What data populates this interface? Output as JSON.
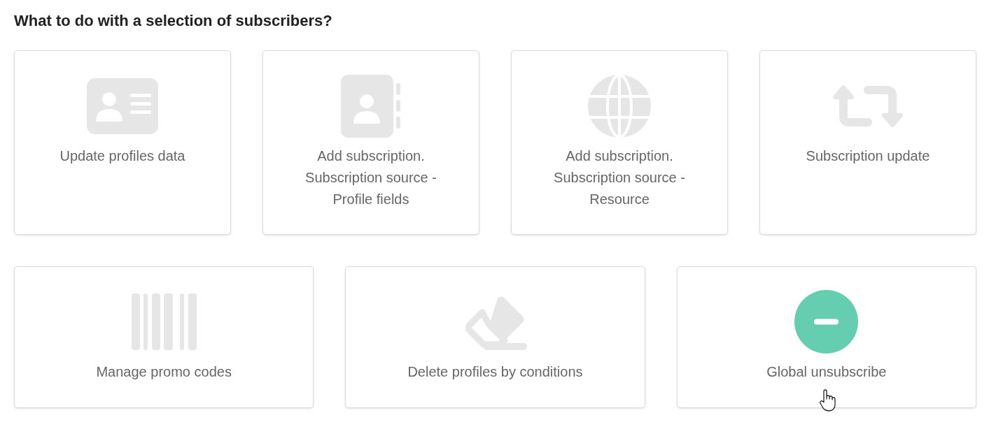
{
  "title": "What to do with a selection of subscribers?",
  "rows": [
    {
      "cards": [
        {
          "kind": "profiles",
          "label": "Update profiles data",
          "highlighted": false
        },
        {
          "kind": "fields",
          "label": "Add subscription. Subscription source - Profile fields",
          "highlighted": false
        },
        {
          "kind": "resource",
          "label": "Add subscription. Subscription source - Resource",
          "highlighted": false
        },
        {
          "kind": "update",
          "label": "Subscription update",
          "highlighted": false
        }
      ]
    },
    {
      "cards": [
        {
          "kind": "promo",
          "label": "Manage promo codes",
          "highlighted": false
        },
        {
          "kind": "delete",
          "label": "Delete profiles by conditions",
          "highlighted": false
        },
        {
          "kind": "unsubscribe",
          "label": "Global unsubscribe",
          "highlighted": true
        }
      ]
    }
  ]
}
